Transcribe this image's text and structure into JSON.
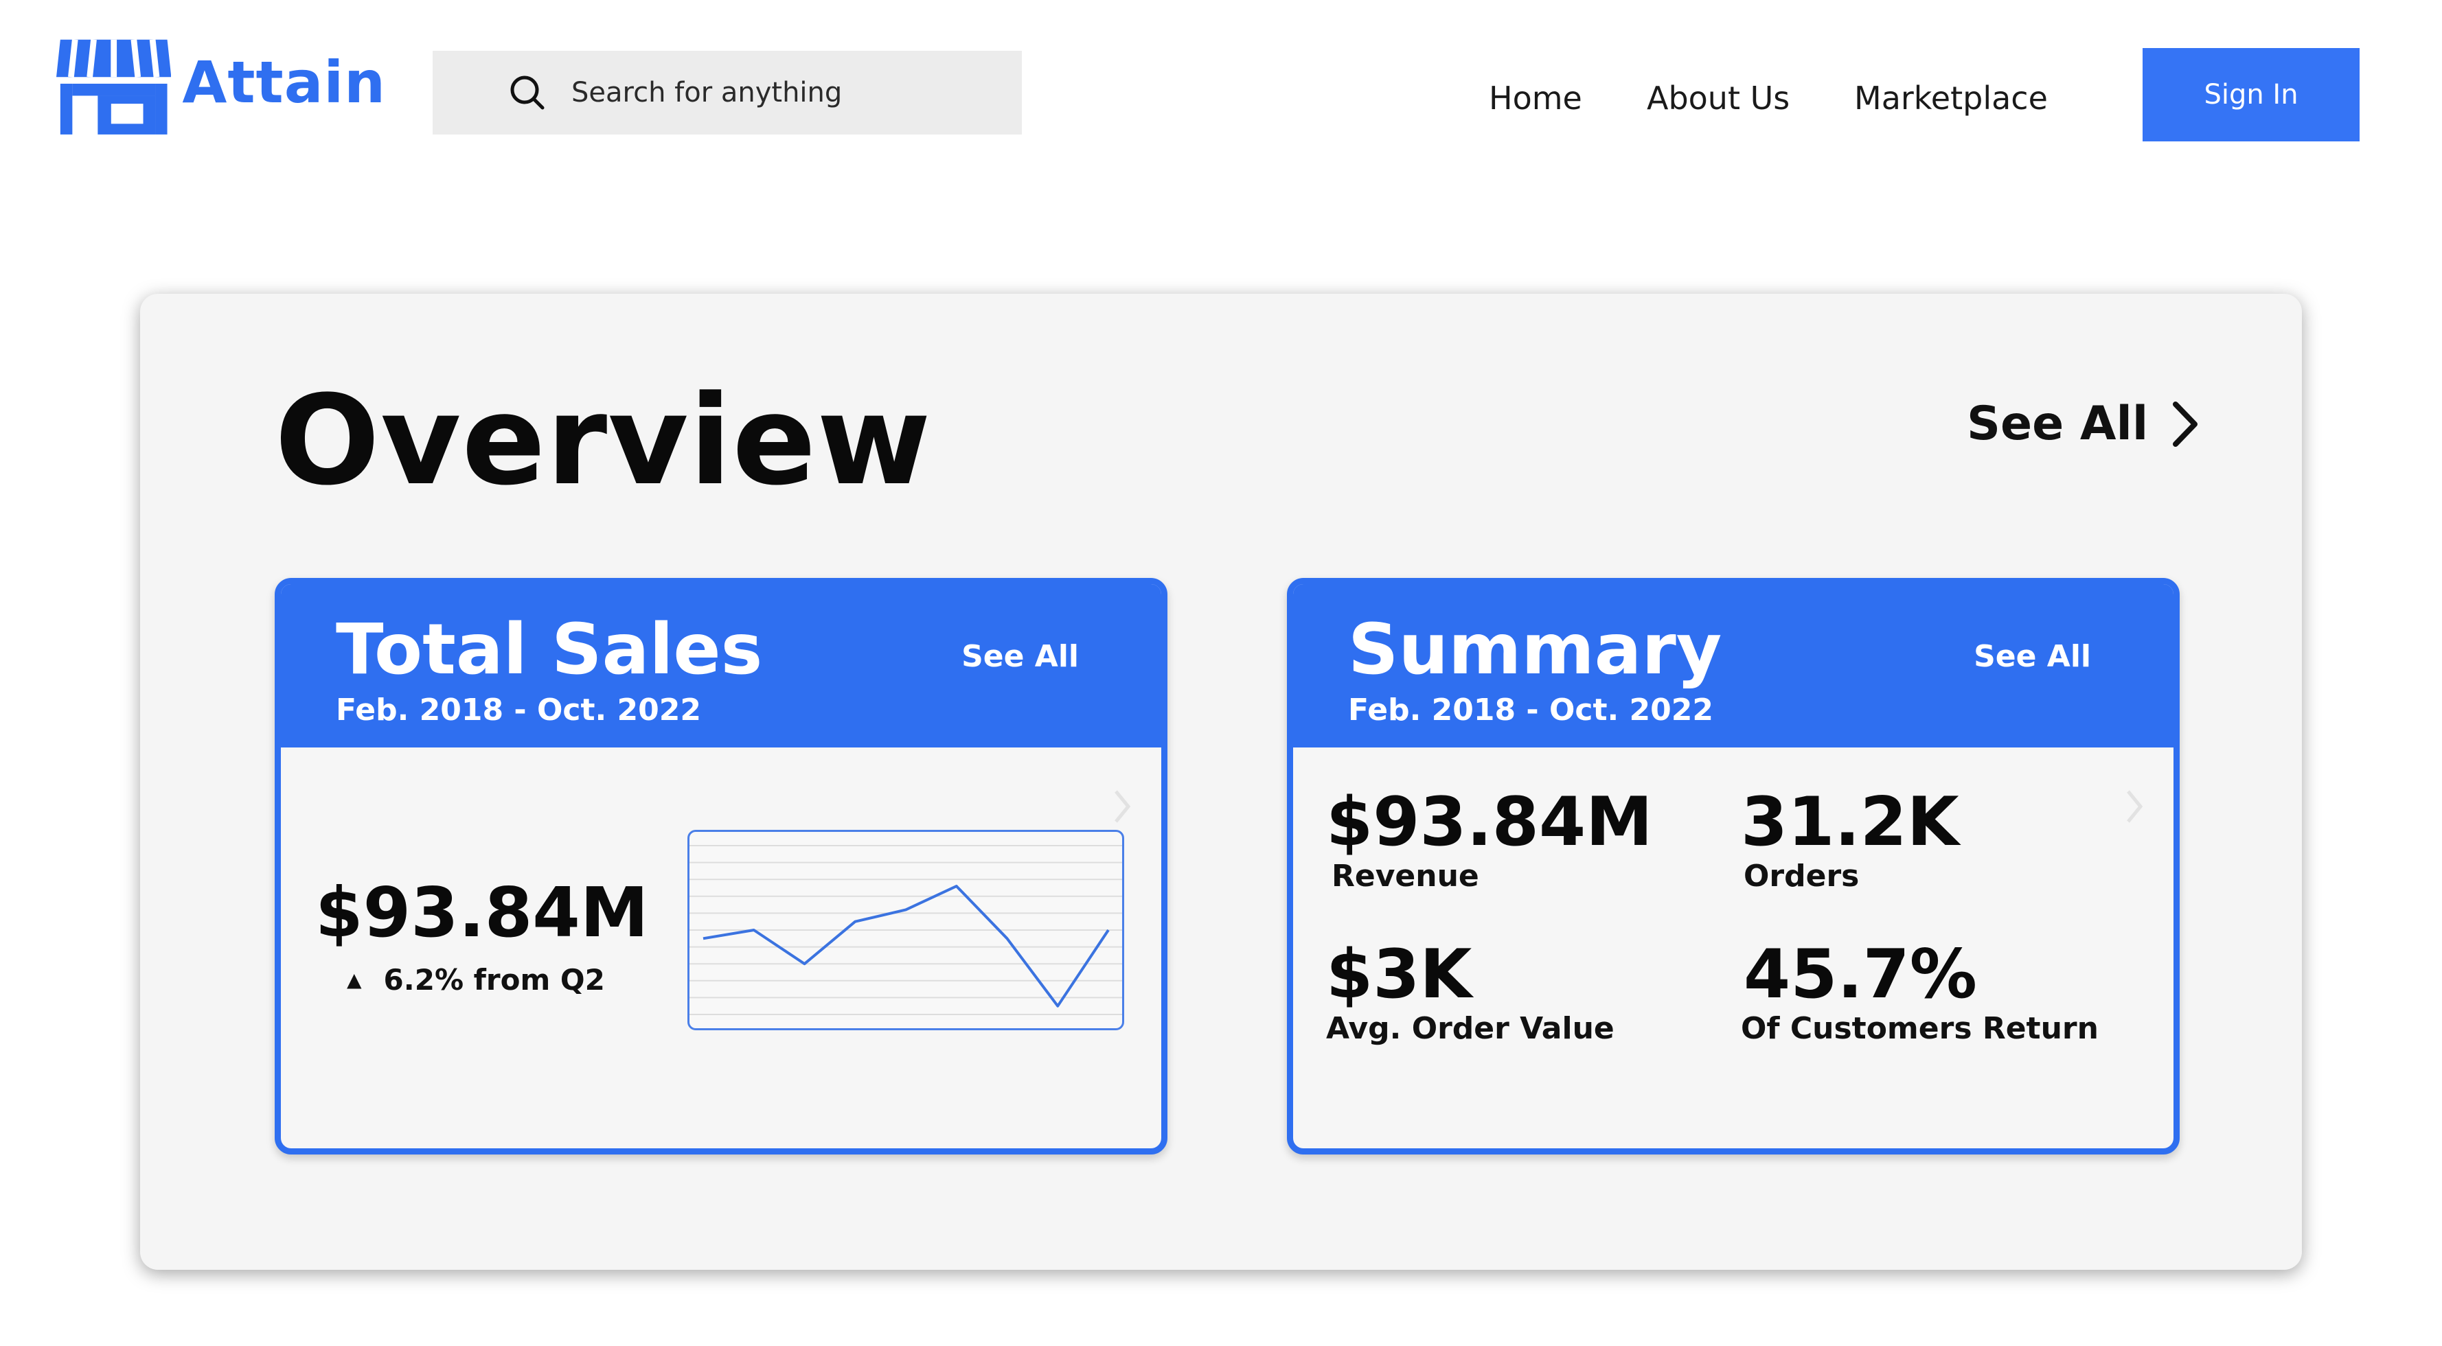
{
  "header": {
    "brand": "Attain",
    "search_placeholder": "Search for anything",
    "nav": [
      "Home",
      "About Us",
      "Marketplace"
    ],
    "sign_in": "Sign In",
    "brand_color": "#2f6ff0",
    "button_color": "#3574f5"
  },
  "overview": {
    "title": "Overview",
    "see_all": "See All"
  },
  "total_sales": {
    "title": "Total Sales",
    "range": "Feb. 2018 - Oct. 2022",
    "see_all": "See All",
    "value": "$93.84M",
    "change": "6.2% from Q2",
    "change_icon": "triangle-up-icon",
    "chart_data": {
      "type": "line",
      "x": [
        1,
        2,
        3,
        4,
        5,
        6,
        7,
        8,
        9
      ],
      "series": [
        {
          "values": [
            45,
            50,
            30,
            55,
            62,
            76,
            45,
            5,
            50
          ]
        }
      ],
      "ylim": [
        0,
        100
      ],
      "grid": true,
      "legend": "none",
      "color": "#3b73e0"
    }
  },
  "summary": {
    "title": "Summary",
    "range": "Feb. 2018 - Oct. 2022",
    "see_all": "See All",
    "metrics": [
      {
        "value": "$93.84M",
        "label": "Revenue"
      },
      {
        "value": "31.2K",
        "label": "Orders"
      },
      {
        "value": "$3K",
        "label": "Avg. Order Value"
      },
      {
        "value": "45.7%",
        "label": "Of Customers Return"
      }
    ]
  }
}
